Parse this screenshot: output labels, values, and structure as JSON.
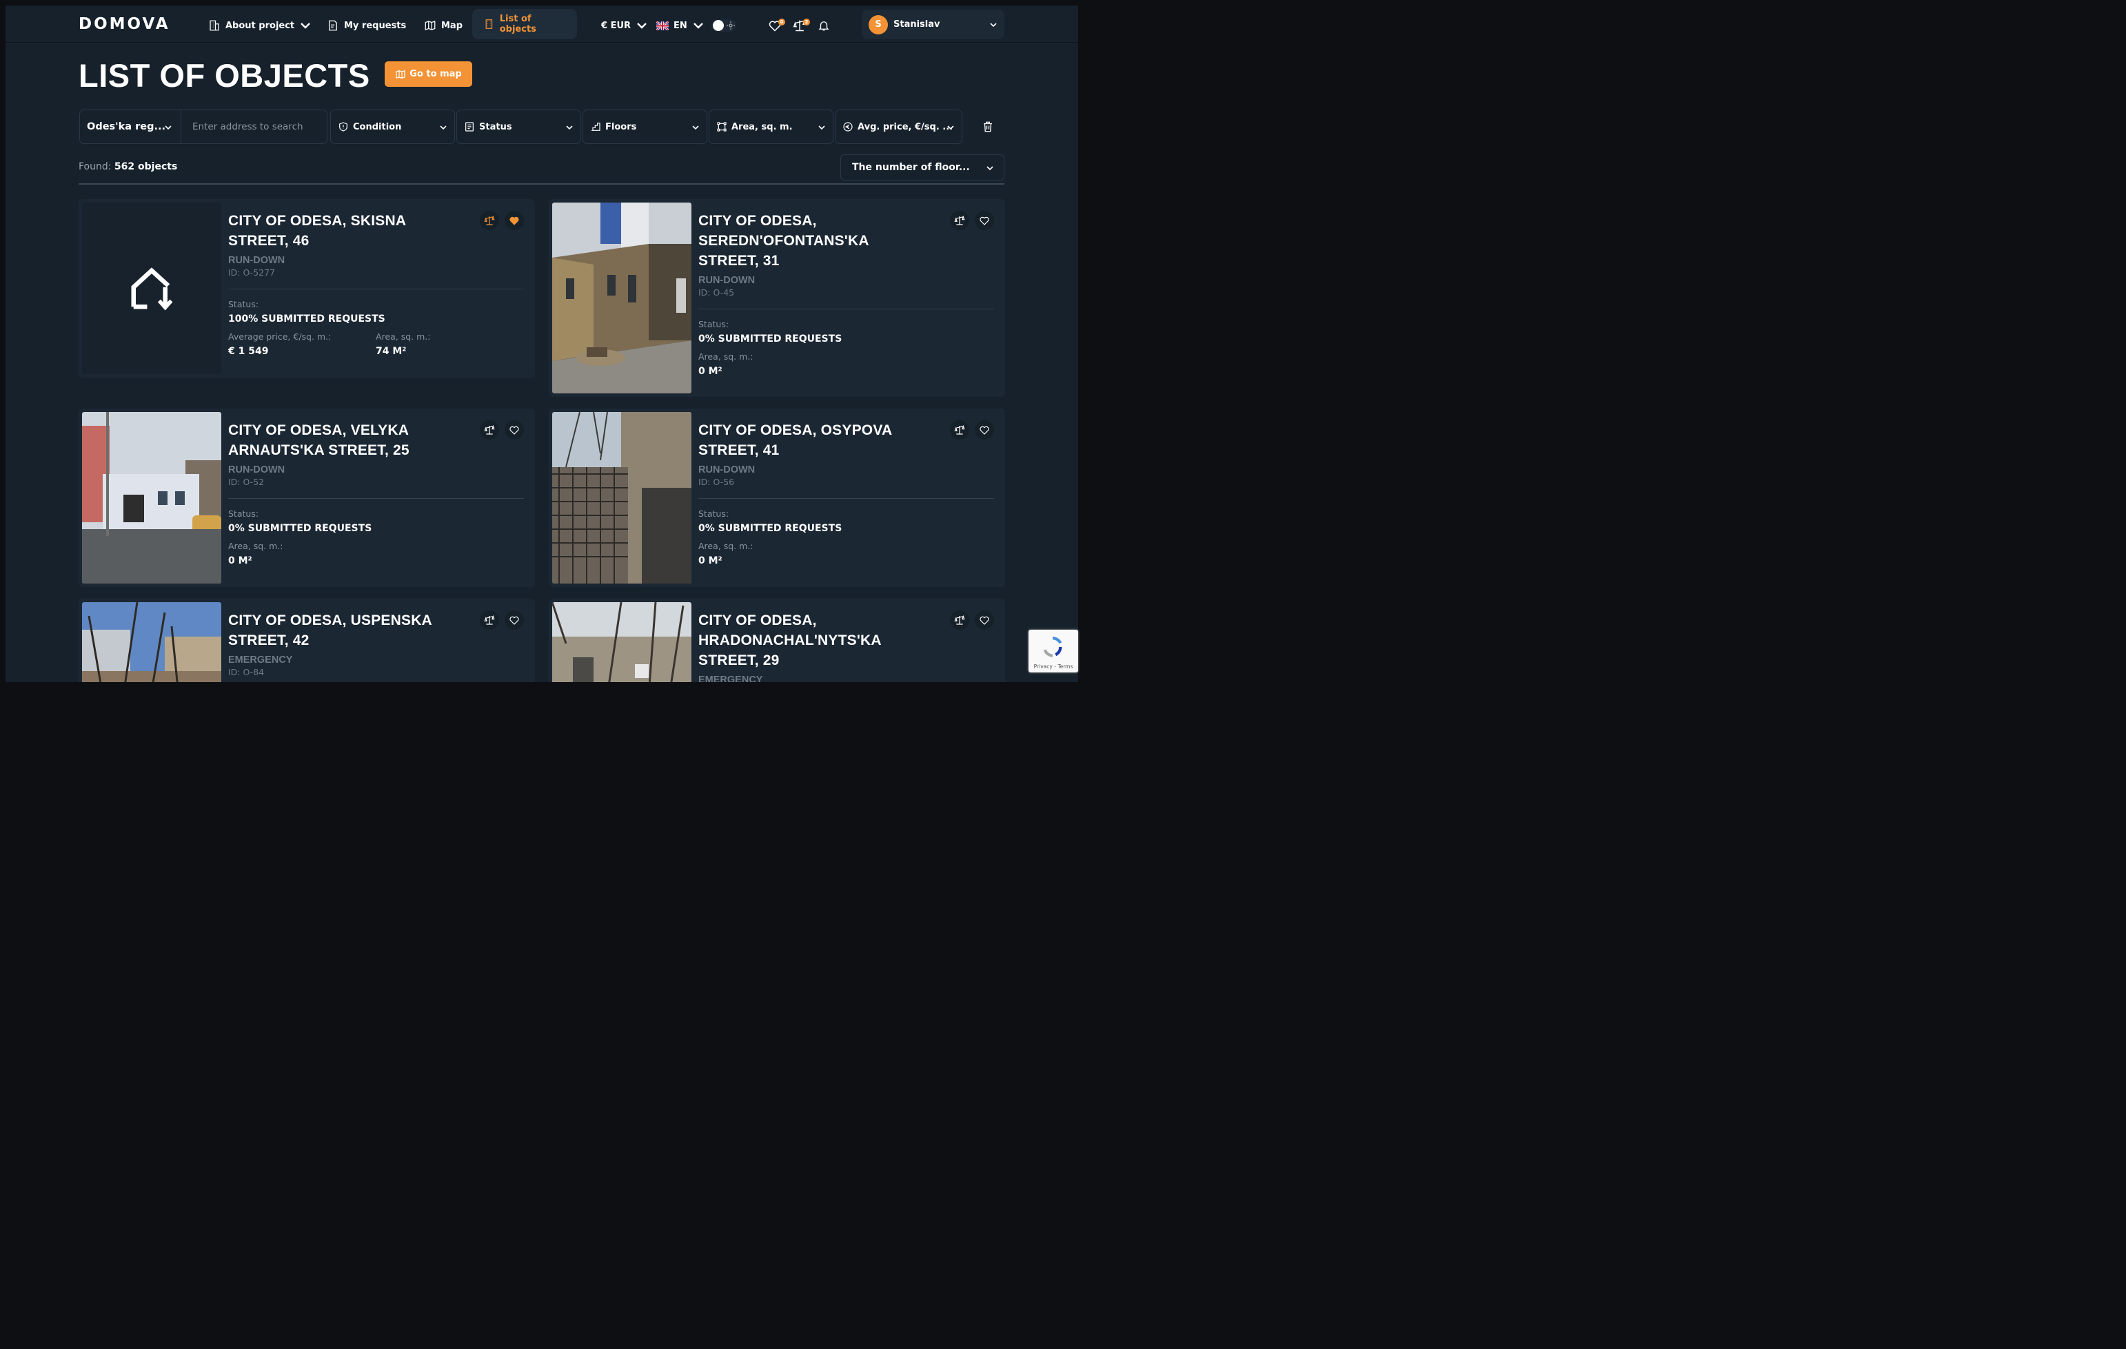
{
  "brand": {
    "logo": "DOMOVA",
    "accent": "#f39335",
    "bg": "#16212c",
    "card_bg": "#1b2733"
  },
  "nav": {
    "about": "About project",
    "requests": "My requests",
    "map": "Map",
    "list": "List of objects",
    "currency": "€ EUR",
    "language": "EN",
    "favorites_count": "0",
    "compare_count": "2",
    "user_initial": "S",
    "user_name": "Stanislav"
  },
  "page": {
    "title": "LIST OF OBJECTS",
    "map_button": "Go to map"
  },
  "filters": {
    "region": "Odes'ka reg...",
    "address_placeholder": "Enter address to search",
    "condition": "Condition",
    "status": "Status",
    "floors": "Floors",
    "area": "Area, sq. m.",
    "avg_price": "Avg. price, €/sq. ..."
  },
  "results": {
    "found_label": "Found:",
    "found_value": "562 objects",
    "sort": "The number of floor..."
  },
  "labels": {
    "status": "Status:",
    "avg_price": "Average price, €/sq. m.:",
    "area": "Area, sq. m.:"
  },
  "cards": [
    {
      "title": "CITY OF ODESA, SKISNA STREET, 46",
      "condition": "RUN-DOWN",
      "id": "ID: O-5277",
      "status": "100% SUBMITTED REQUESTS",
      "avg_price": "€ 1 549",
      "area": "74 M²"
    },
    {
      "title": "CITY OF ODESA, SEREDN'OFONTANS'KA STREET, 31",
      "condition": "RUN-DOWN",
      "id": "ID: O-45",
      "status": "0% SUBMITTED REQUESTS",
      "area": "0 M²"
    },
    {
      "title": "CITY OF ODESA, VELYKA ARNAUTS'KA STREET, 25",
      "condition": "RUN-DOWN",
      "id": "ID: O-52",
      "status": "0% SUBMITTED REQUESTS",
      "area": "0 M²"
    },
    {
      "title": "CITY OF ODESA, OSYPOVA STREET, 41",
      "condition": "RUN-DOWN",
      "id": "ID: O-56",
      "status": "0% SUBMITTED REQUESTS",
      "area": "0 M²"
    },
    {
      "title": "CITY OF ODESA, USPENSKA STREET, 42",
      "condition": "EMERGENCY",
      "id": "ID: O-84"
    },
    {
      "title": "CITY OF ODESA, HRADONACHAL'NYTS'KA STREET, 29",
      "condition": "EMERGENCY"
    }
  ],
  "recaptcha": {
    "text": "Privacy - Terms"
  }
}
